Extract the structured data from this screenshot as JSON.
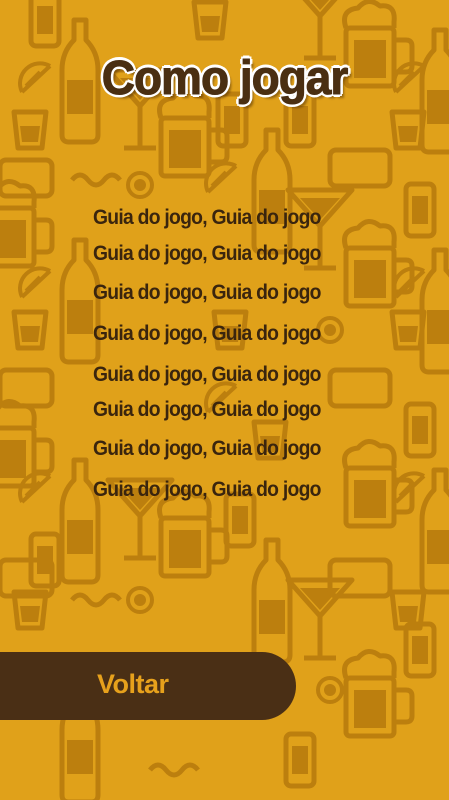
{
  "screen": {
    "title": "Como jogar",
    "guide_lines": [
      "Guia do jogo, Guia do jogo",
      "Guia do jogo, Guia do jogo",
      "Guia do jogo, Guia do jogo",
      "Guia do jogo, Guia do jogo",
      "Guia do jogo, Guia do jogo",
      "Guia do jogo, Guia do jogo",
      "Guia do jogo, Guia do jogo",
      "Guia do jogo, Guia do jogo"
    ],
    "back_button_label": "Voltar"
  },
  "colors": {
    "background": "#e0a11a",
    "pattern": "#b87c0e",
    "text_dark": "#3a250e",
    "button_bg": "#4a2f15",
    "button_text": "#e7a11c"
  },
  "icons": [
    "beer-bottle-icon",
    "beer-mug-icon",
    "cocktail-glass-icon",
    "shot-glass-icon",
    "lemon-slice-icon",
    "can-icon"
  ]
}
